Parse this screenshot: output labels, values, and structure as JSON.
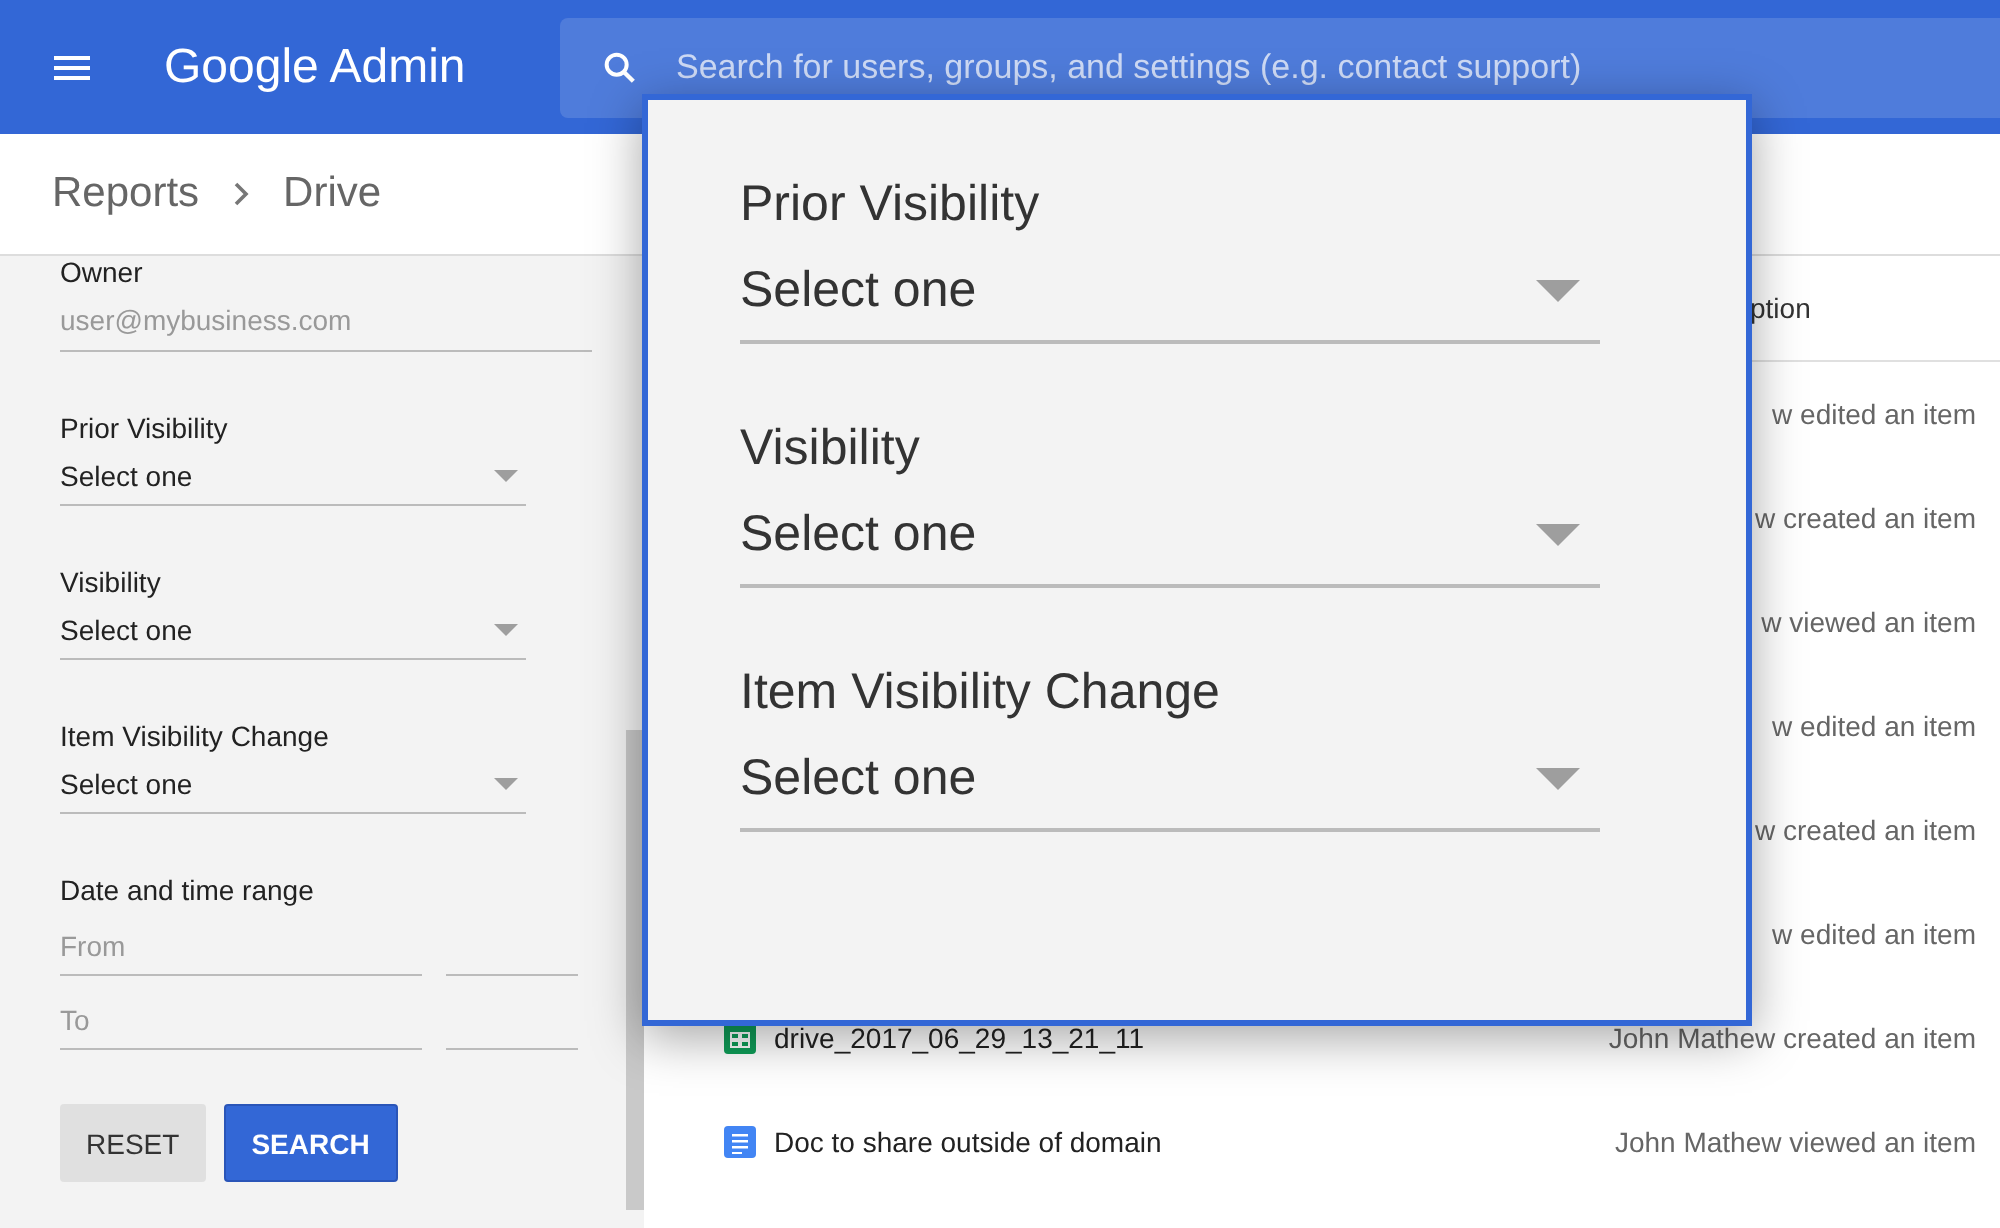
{
  "header": {
    "app_name": "Google Admin",
    "search": {
      "placeholder": "Search for users, groups, and settings (e.g. contact support)"
    }
  },
  "breadcrumb": [
    "Reports",
    "Drive"
  ],
  "filters": {
    "owner": {
      "label": "Owner",
      "placeholder": "user@mybusiness.com"
    },
    "selects": [
      {
        "label": "Prior Visibility",
        "value": "Select one"
      },
      {
        "label": "Visibility",
        "value": "Select one"
      },
      {
        "label": "Item Visibility Change",
        "value": "Select one"
      }
    ],
    "date_range": {
      "label": "Date and time range",
      "from_placeholder": "From",
      "to_placeholder": "To"
    },
    "buttons": [
      {
        "label": "RESET",
        "kind": "secondary"
      },
      {
        "label": "SEARCH",
        "kind": "primary"
      }
    ]
  },
  "table": {
    "columns": [
      {
        "label": "ption"
      }
    ],
    "rows": [
      {
        "description": "w edited an item"
      },
      {
        "description": "w created an item"
      },
      {
        "description": "w viewed an item"
      },
      {
        "description": "w edited an item"
      },
      {
        "description": "w created an item"
      },
      {
        "description": "w edited an item"
      },
      {
        "name": "drive_2017_06_29_13_21_11",
        "kind": "sheet",
        "description": "John Mathew created an item"
      },
      {
        "name": "Doc to share outside of domain",
        "kind": "doc",
        "description": "John Mathew viewed an item"
      }
    ]
  },
  "zoom_callout": {
    "selects": [
      {
        "label": "Prior Visibility",
        "value": "Select one"
      },
      {
        "label": "Visibility",
        "value": "Select one"
      },
      {
        "label": "Item Visibility Change",
        "value": "Select one"
      }
    ]
  }
}
